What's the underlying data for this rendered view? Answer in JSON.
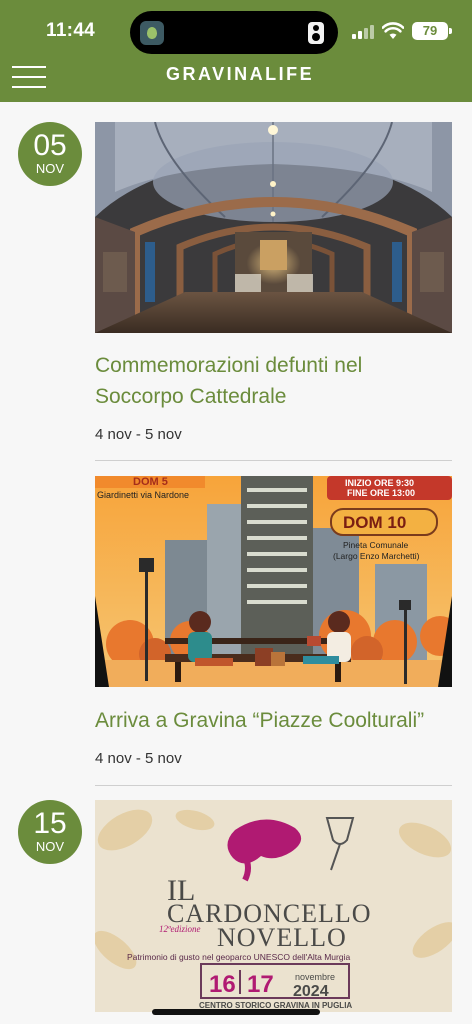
{
  "status_bar": {
    "time": "11:44",
    "battery": "79"
  },
  "header": {
    "brand": "GRAVINALIFE"
  },
  "events": [
    {
      "day": "05",
      "month": "NOV",
      "title": "Commemorazioni defunti nel Soccorpo Cattedrale",
      "date_range": "4 nov - 5 nov"
    },
    {
      "title": "Arriva a Gravina “Piazze Coolturali”",
      "date_range": "4 nov - 5 nov",
      "poster": {
        "top_banner": "DOM 5",
        "location_left": "Giardinetti via Nardone",
        "time_start": "INIZIO ORE 9:30",
        "time_end": "FINE ORE 13:00",
        "day_badge": "DOM 10",
        "location_right_1": "Pineta Comunale",
        "location_right_2": "(Largo Enzo Marchetti)"
      }
    },
    {
      "day": "15",
      "month": "NOV",
      "poster": {
        "title_1": "IL",
        "title_2": "CARDONCELLO",
        "title_3": "NOVELLO",
        "edition": "12ªedizione",
        "tagline": "Patrimonio di gusto nel geoparco UNESCO dell'Alta Murgia",
        "day_1": "16",
        "day_2": "17",
        "month_year_1": "novembre",
        "month_year_2": "2024",
        "place": "CENTRO STORICO GRAVINA IN PUGLIA"
      }
    }
  ]
}
